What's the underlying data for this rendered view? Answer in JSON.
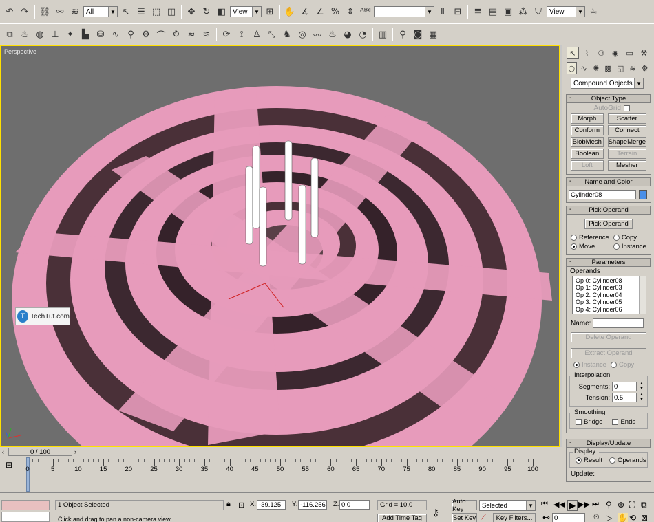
{
  "toolbar": {
    "selection_filter": "All",
    "coord_view": "View",
    "named_selection": "",
    "coord_view_2": "View"
  },
  "viewport": {
    "label": "Perspective",
    "watermark": "TechTut.com"
  },
  "command_panel": {
    "category": "Compound Objects",
    "object_type": {
      "header": "Object Type",
      "autogrid": "AutoGrid",
      "buttons": [
        {
          "label": "Morph",
          "enabled": true
        },
        {
          "label": "Scatter",
          "enabled": true
        },
        {
          "label": "Conform",
          "enabled": true
        },
        {
          "label": "Connect",
          "enabled": true
        },
        {
          "label": "BlobMesh",
          "enabled": true
        },
        {
          "label": "ShapeMerge",
          "enabled": true
        },
        {
          "label": "Boolean",
          "enabled": true
        },
        {
          "label": "Terrain",
          "enabled": false
        },
        {
          "label": "Loft",
          "enabled": false
        },
        {
          "label": "Mesher",
          "enabled": true
        }
      ]
    },
    "name_and_color": {
      "header": "Name and Color",
      "name": "Cylinder08",
      "color": "#4a8fe8"
    },
    "pick_operand": {
      "header": "Pick Operand",
      "button": "Pick Operand",
      "options": [
        "Reference",
        "Copy",
        "Move",
        "Instance"
      ],
      "selected": "Move"
    },
    "parameters": {
      "header": "Parameters",
      "operands_label": "Operands",
      "operands": [
        "Op 0: Cylinder08",
        "Op 1: Cylinder03",
        "Op 2: Cylinder04",
        "Op 3: Cylinder05",
        "Op 4: Cylinder06"
      ],
      "name_label": "Name:",
      "name_value": "",
      "delete_operand": "Delete Operand",
      "extract_operand": "Extract Operand",
      "instance": "Instance",
      "copy": "Copy",
      "interpolation": "Interpolation",
      "segments_label": "Segments:",
      "segments": "0",
      "tension_label": "Tension:",
      "tension": "0.5",
      "smoothing": "Smoothing",
      "bridge": "Bridge",
      "ends": "Ends"
    },
    "display_update": {
      "header": "Display/Update",
      "display": "Display:",
      "result": "Result",
      "operands": "Operands",
      "update": "Update:"
    }
  },
  "timeline": {
    "frame": "0 / 100",
    "ticks": [
      "0",
      "5",
      "10",
      "15",
      "20",
      "25",
      "30",
      "35",
      "40",
      "45",
      "50",
      "55",
      "60",
      "65",
      "70",
      "75",
      "80",
      "85",
      "90",
      "95",
      "100"
    ]
  },
  "status": {
    "selected": "1 Object Selected",
    "prompt": "Click and drag to pan a non-camera view",
    "x_label": "X:",
    "x": "-39.125",
    "y_label": "Y:",
    "y": "-116.256",
    "z_label": "Z:",
    "z": "0.0",
    "grid": "Grid = 10.0",
    "add_time_tag": "Add Time Tag",
    "auto_key": "Auto Key",
    "set_key": "Set Key",
    "key_mode": "Selected",
    "key_filters": "Key Filters...",
    "current_frame": "0"
  }
}
